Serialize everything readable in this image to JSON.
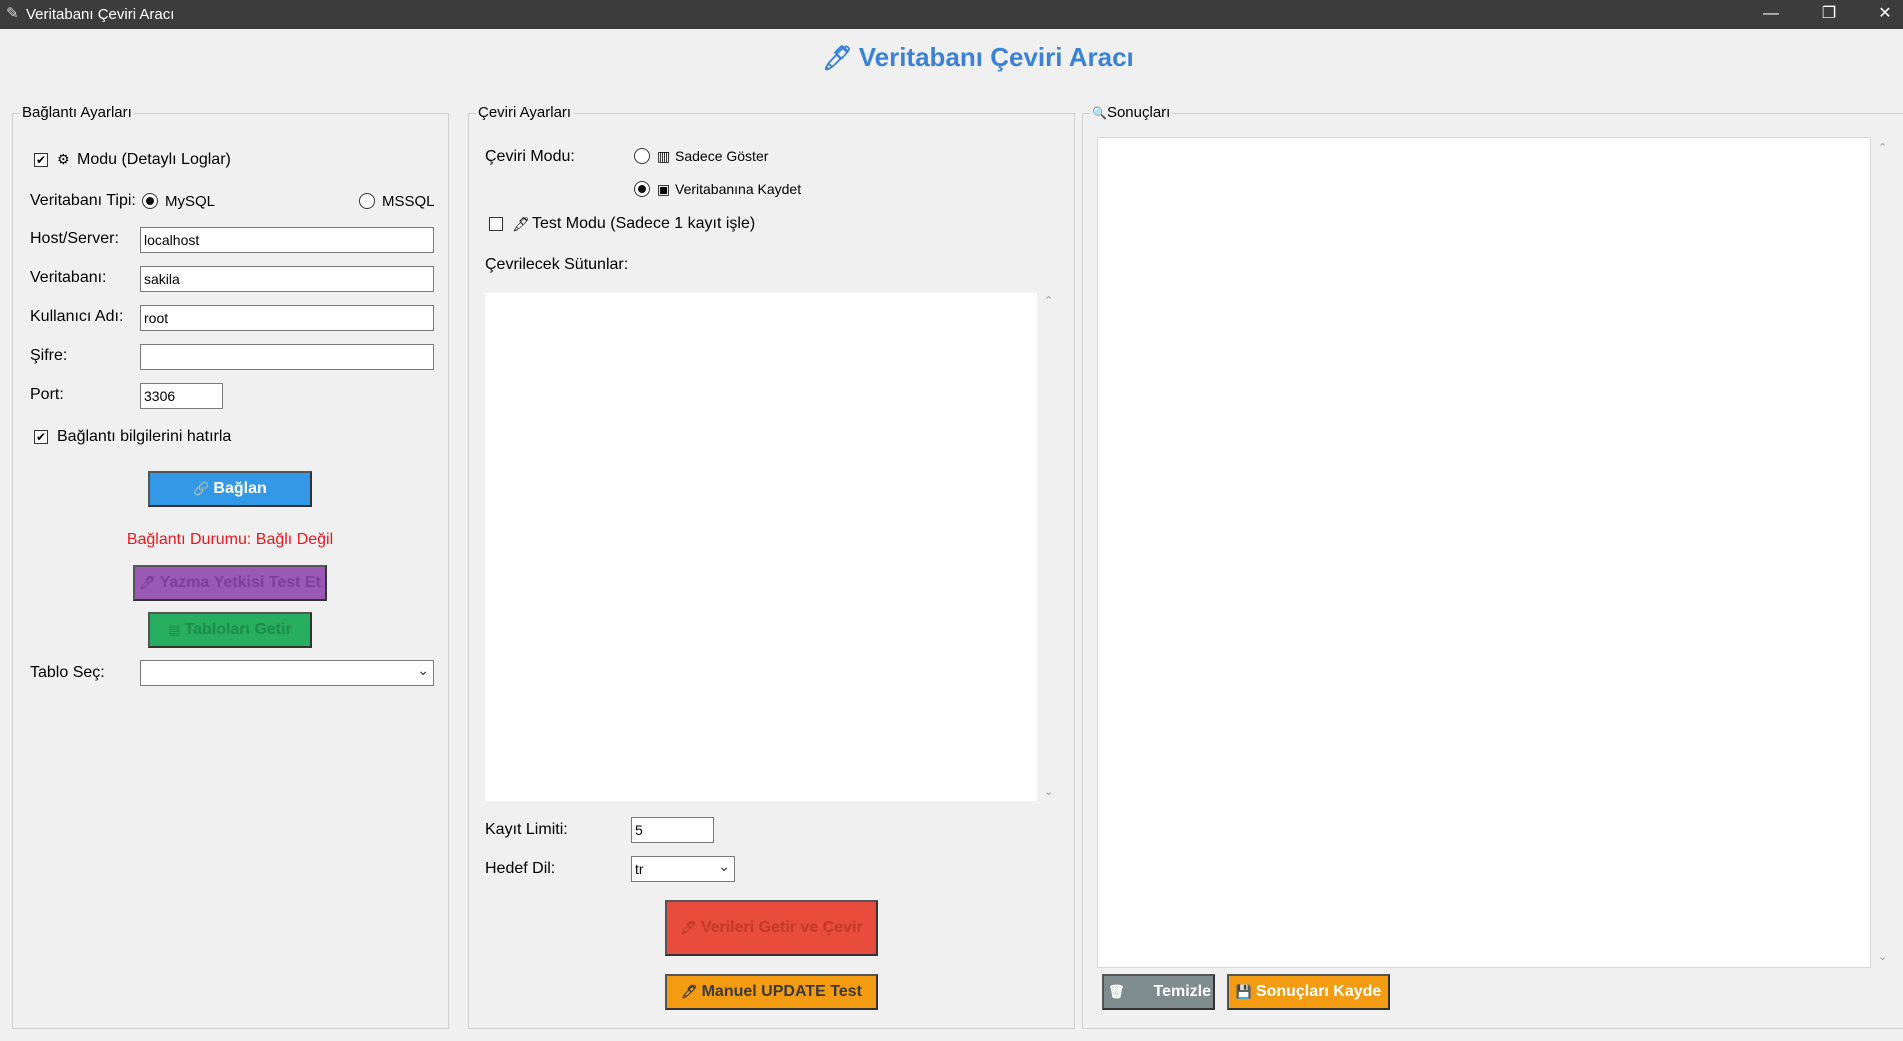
{
  "window": {
    "title": "Veritabanı Çeviri Aracı",
    "app_icon": "feather-icon",
    "controls": {
      "minimize": "—",
      "restore": "❐",
      "close": "✕"
    }
  },
  "heading": {
    "icon": "🖊",
    "text": "Veritabanı Çeviri Aracı",
    "color": "#3b82d6"
  },
  "connection": {
    "group_title": "Bağlantı Ayarları",
    "debug_mode": {
      "label": "Modu (Detaylı Loglar)",
      "icon": "⚙",
      "checked": true
    },
    "db_type": {
      "label": "Veritabanı Tipi:",
      "options": [
        "MySQL",
        "MSSQL"
      ],
      "selected": "MySQL"
    },
    "host": {
      "label": "Host/Server:",
      "value": "localhost"
    },
    "database": {
      "label": "Veritabanı:",
      "value": "sakila"
    },
    "username": {
      "label": "Kullanıcı Adı:",
      "value": "root"
    },
    "password": {
      "label": "Şifre:",
      "value": ""
    },
    "port": {
      "label": "Port:",
      "value": "3306"
    },
    "remember": {
      "label": "Bağlantı bilgilerini hatırla",
      "checked": true
    },
    "connect_button": {
      "label": "Bağlan",
      "icon": "🔗",
      "color": "#3399e6"
    },
    "status": {
      "text": "Bağlantı Durumu: Bağlı Değil",
      "color": "#e8191e"
    },
    "write_test_button": {
      "label": "Yazma Yetkisi Test Et",
      "icon": "🖊",
      "color": "#9b59b6"
    },
    "fetch_tables_button": {
      "label": "Tabloları Getir",
      "icon": "▤",
      "color": "#27ae60"
    },
    "table_select": {
      "label": "Tablo Seç:",
      "value": ""
    }
  },
  "translation": {
    "group_title": "Çeviri Ayarları",
    "mode_label": "Çeviri Modu:",
    "mode_options": [
      {
        "label": "Sadece Göster",
        "icon": "▥",
        "selected": false
      },
      {
        "label": "Veritabanına Kaydet",
        "icon": "▣",
        "selected": true
      }
    ],
    "test_mode": {
      "label": "Test Modu (Sadece 1 kayıt işle)",
      "icon": "🖋",
      "checked": false
    },
    "columns_label": "Çevrilecek Sütunlar:",
    "record_limit": {
      "label": "Kayıt Limiti:",
      "value": "5"
    },
    "target_lang": {
      "label": "Hedef Dil:",
      "value": "tr"
    },
    "fetch_translate_button": {
      "label": "Verileri Getir ve Çevir",
      "icon": "🖊",
      "color": "#e74c3c"
    },
    "manual_update_button": {
      "label": "Manuel UPDATE Test",
      "icon": "🖊",
      "color": "#f39c12"
    }
  },
  "results": {
    "group_title": "Sonuçları",
    "icon": "🔍",
    "clear_button": {
      "label": "Temizle",
      "icon": "🗑",
      "color": "#7f8c8d"
    },
    "save_button": {
      "label": "Sonuçları Kayde",
      "icon": "💾",
      "color": "#f39c12"
    }
  }
}
